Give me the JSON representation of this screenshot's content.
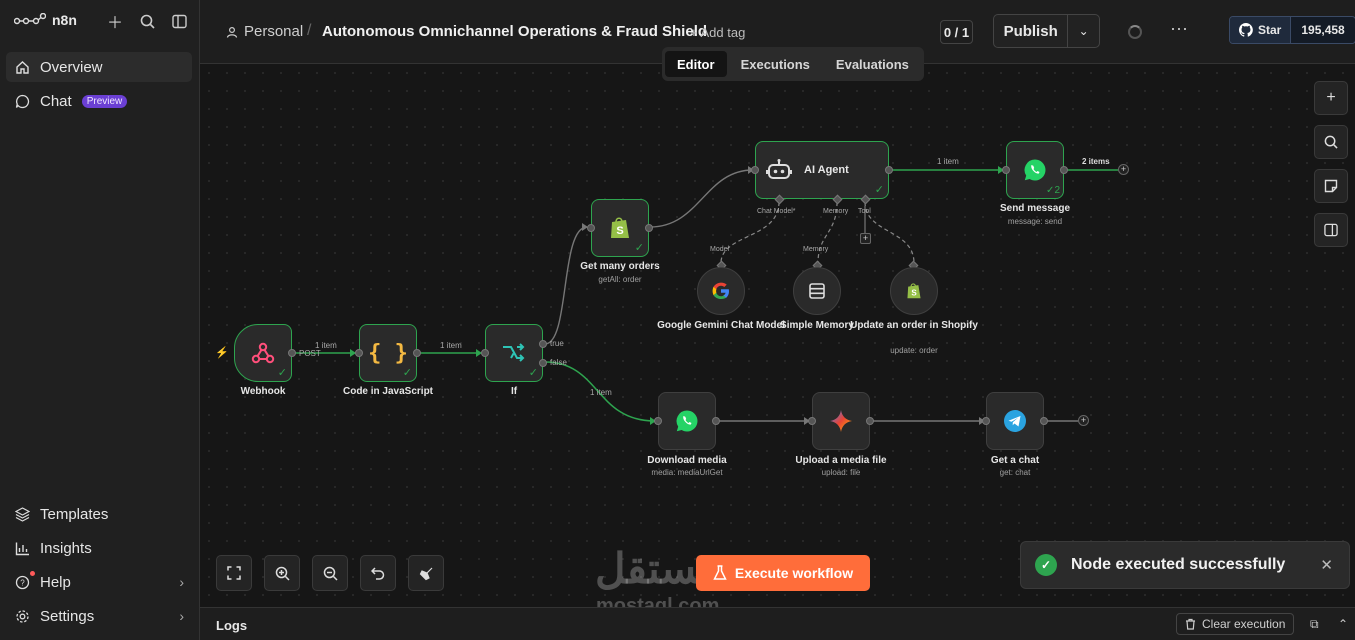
{
  "sidebar": {
    "brand": "n8n",
    "items": [
      {
        "label": "Overview"
      },
      {
        "label": "Chat",
        "badge": "Preview"
      }
    ],
    "bottom": [
      {
        "label": "Templates"
      },
      {
        "label": "Insights"
      },
      {
        "label": "Help"
      },
      {
        "label": "Settings"
      }
    ]
  },
  "header": {
    "project": "Personal",
    "workflow_title": "Autonomous Omnichannel Operations & Fraud Shield",
    "add_tag": "+ Add tag",
    "counter": "0 / 1",
    "publish": "Publish",
    "github_star": "Star",
    "github_count": "195,458",
    "tabs": [
      {
        "label": "Editor",
        "active": true
      },
      {
        "label": "Executions"
      },
      {
        "label": "Evaluations"
      }
    ]
  },
  "nodes": {
    "webhook": {
      "label": "Webhook"
    },
    "code": {
      "label": "Code in JavaScript"
    },
    "if": {
      "label": "If"
    },
    "get_orders": {
      "label": "Get many orders",
      "sub": "getAll: order"
    },
    "agent": {
      "label": "AI Agent",
      "ports": [
        "Chat Model*",
        "Memory",
        "Tool"
      ]
    },
    "send_message": {
      "label": "Send message",
      "sub": "message: send",
      "runs": "2"
    },
    "gemini": {
      "label": "Google Gemini Chat Model",
      "port": "Model"
    },
    "memory": {
      "label": "Simple Memory",
      "port": "Memory"
    },
    "shopify_update": {
      "label": "Update an order in Shopify",
      "sub": "update: order"
    },
    "download_media": {
      "label": "Download media",
      "sub": "media: mediaUrlGet"
    },
    "upload_media": {
      "label": "Upload a media file",
      "sub": "upload: file"
    },
    "get_chat": {
      "label": "Get a chat",
      "sub": "get: chat"
    }
  },
  "edges": {
    "webhook_code": "1 item",
    "webhook_method": "POST",
    "code_if": "1 item",
    "if_true": "true",
    "if_false": "false",
    "false_download": "1 item",
    "agent_send": "1 item",
    "send_out": "2 items"
  },
  "toolbar": {
    "execute": "Execute workflow"
  },
  "watermark": {
    "arabic": "مستقل",
    "latin": "mostaql.com"
  },
  "toast": {
    "message": "Node executed successfully"
  },
  "logs": {
    "title": "Logs",
    "clear": "Clear execution"
  },
  "colors": {
    "success": "#2ea44f",
    "accent": "#ff6d3a",
    "preview_badge": "#6b3fd4"
  }
}
